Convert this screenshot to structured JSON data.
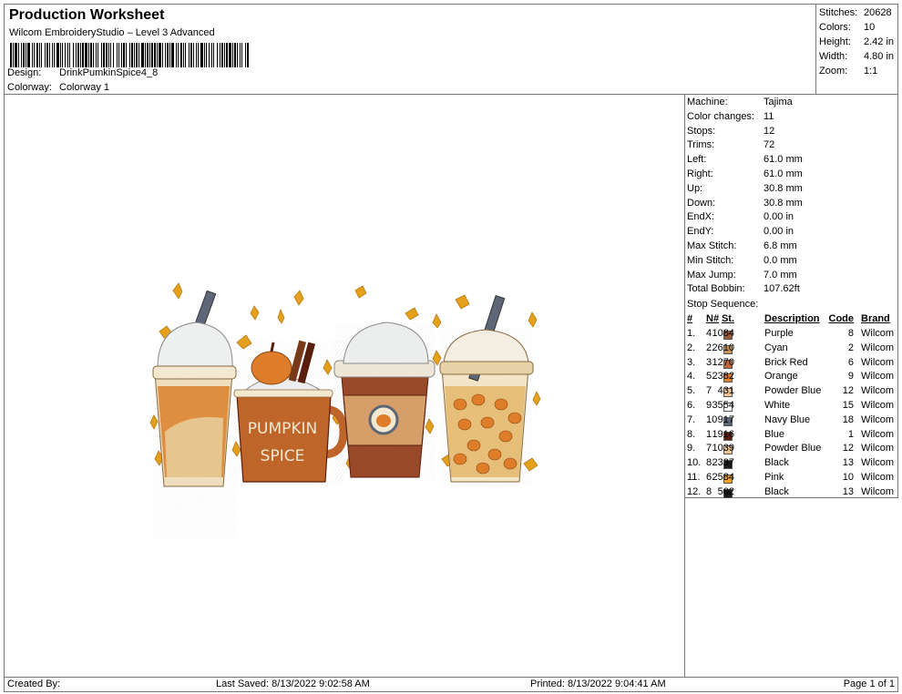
{
  "header": {
    "title": "Production Worksheet",
    "subtitle": "Wilcom EmbroideryStudio – Level 3 Advanced",
    "design_label": "Design:",
    "design_value": "DrinkPumkinSpice4_8",
    "colorway_label": "Colorway:",
    "colorway_value": "Colorway 1"
  },
  "stats": [
    {
      "label": "Stitches:",
      "value": "20628"
    },
    {
      "label": "Colors:",
      "value": "10"
    },
    {
      "label": "Height:",
      "value": "2.42 in"
    },
    {
      "label": "Width:",
      "value": "4.80 in"
    },
    {
      "label": "Zoom:",
      "value": "1:1"
    }
  ],
  "machine_info": [
    {
      "label": "Machine:",
      "value": "Tajima"
    },
    {
      "label": "Color changes:",
      "value": "11"
    },
    {
      "label": "Stops:",
      "value": "12"
    },
    {
      "label": "Trims:",
      "value": "72"
    },
    {
      "label": "Left:",
      "value": "61.0 mm"
    },
    {
      "label": "Right:",
      "value": "61.0 mm"
    },
    {
      "label": "Up:",
      "value": "30.8 mm"
    },
    {
      "label": "Down:",
      "value": "30.8 mm"
    },
    {
      "label": "EndX:",
      "value": "0.00 in"
    },
    {
      "label": "EndY:",
      "value": "0.00 in"
    },
    {
      "label": "Max Stitch:",
      "value": "6.8 mm"
    },
    {
      "label": "Min Stitch:",
      "value": "0.0 mm"
    },
    {
      "label": "Max Jump:",
      "value": "7.0 mm"
    },
    {
      "label": "Total Bobbin:",
      "value": "107.62ft"
    }
  ],
  "stop_sequence": {
    "title": "Stop Sequence:",
    "headers": {
      "num": "#",
      "n": "N#",
      "st": "St.",
      "description": "Description",
      "code": "Code",
      "brand": "Brand"
    },
    "rows": [
      {
        "num": "1.",
        "n": "4",
        "color": "#9a5a3a",
        "st": "1084",
        "description": "Purple",
        "code": "8",
        "brand": "Wilcom"
      },
      {
        "num": "2.",
        "n": "2",
        "color": "#c8945c",
        "st": "2610",
        "description": "Cyan",
        "code": "2",
        "brand": "Wilcom"
      },
      {
        "num": "3.",
        "n": "3",
        "color": "#c0663a",
        "st": "1270",
        "description": "Brick Red",
        "code": "6",
        "brand": "Wilcom"
      },
      {
        "num": "4.",
        "n": "5",
        "color": "#e07e2a",
        "st": "2382",
        "description": "Orange",
        "code": "9",
        "brand": "Wilcom"
      },
      {
        "num": "5.",
        "n": "7",
        "color": "#eec497",
        "st": "431",
        "description": "Powder Blue",
        "code": "12",
        "brand": "Wilcom"
      },
      {
        "num": "6.",
        "n": "9",
        "color": "#ffffff",
        "st": "3554",
        "description": "White",
        "code": "15",
        "brand": "Wilcom"
      },
      {
        "num": "7.",
        "n": "10",
        "color": "#5e6777",
        "st": "917",
        "description": "Navy Blue",
        "code": "18",
        "brand": "Wilcom"
      },
      {
        "num": "8.",
        "n": "1",
        "color": "#5a1e0c",
        "st": "1916",
        "description": "Blue",
        "code": "1",
        "brand": "Wilcom"
      },
      {
        "num": "9.",
        "n": "7",
        "color": "#eec497",
        "st": "1039",
        "description": "Powder Blue",
        "code": "12",
        "brand": "Wilcom"
      },
      {
        "num": "10.",
        "n": "8",
        "color": "#1a1a1a",
        "st": "2337",
        "description": "Black",
        "code": "13",
        "brand": "Wilcom"
      },
      {
        "num": "11.",
        "n": "6",
        "color": "#f0a020",
        "st": "2584",
        "description": "Pink",
        "code": "10",
        "brand": "Wilcom"
      },
      {
        "num": "12.",
        "n": "8",
        "color": "#1a1a1a",
        "st": "502",
        "description": "Black",
        "code": "13",
        "brand": "Wilcom"
      }
    ]
  },
  "design_art": {
    "mug_text_line1": "PUMPKIN",
    "mug_text_line2": "SPICE"
  },
  "footer": {
    "created_by": "Created By:",
    "last_saved": "Last Saved: 8/13/2022 9:02:58 AM",
    "printed": "Printed: 8/13/2022 9:04:41 AM",
    "page": "Page 1 of 1"
  }
}
